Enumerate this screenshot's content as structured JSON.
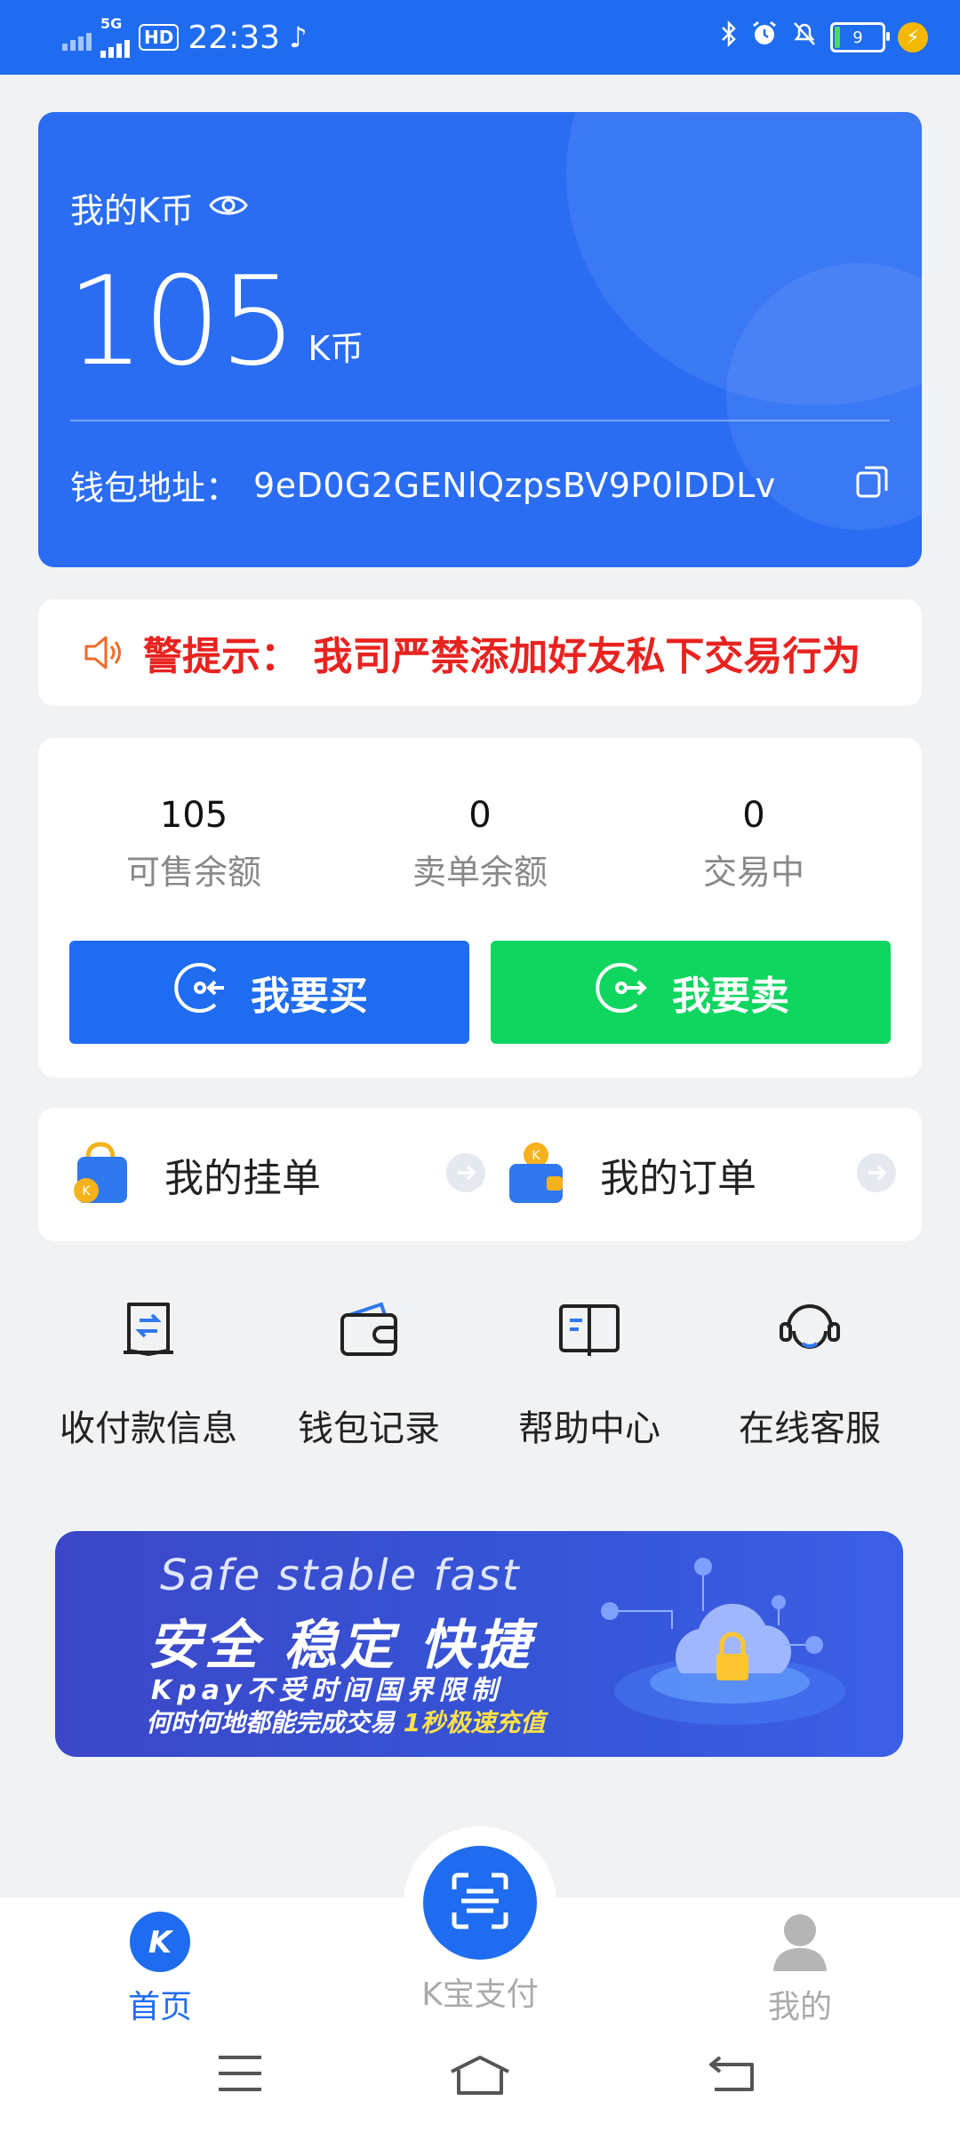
{
  "status_bar": {
    "network": "5G",
    "hd": "HD",
    "time": "22:33",
    "battery": "9"
  },
  "wallet_card": {
    "title": "我的K币",
    "amount": "105",
    "unit": "K币",
    "address_label": "钱包地址：",
    "address_value": "9eD0G2GENlQzpsBV9P0lDDLv"
  },
  "notice": {
    "text": "警提示：  我司严禁添加好友私下交易行为"
  },
  "balances": [
    {
      "value": "105",
      "label": "可售余额"
    },
    {
      "value": "0",
      "label": "卖单余额"
    },
    {
      "value": "0",
      "label": "交易中"
    }
  ],
  "actions": {
    "buy_label": "我要买",
    "sell_label": "我要卖"
  },
  "orders": {
    "my_listings": "我的挂单",
    "my_orders": "我的订单"
  },
  "quick_links": [
    {
      "label": "收付款信息",
      "icon": "receipt-exchange-icon"
    },
    {
      "label": "钱包记录",
      "icon": "wallet-icon"
    },
    {
      "label": "帮助中心",
      "icon": "book-icon"
    },
    {
      "label": "在线客服",
      "icon": "headset-icon"
    }
  ],
  "banner": {
    "line1": "Safe  stable  fast",
    "line2": "安全  稳定  快捷",
    "line3": "Kpay不受时间国界限制",
    "line4_prefix": "何时何地都能完成交易 ",
    "line4_highlight": "1秒极速充值"
  },
  "tab_bar": {
    "home": "首页",
    "pay": "K宝支付",
    "mine": "我的",
    "active_color": "#1f6cf0",
    "inactive_color": "#aaaaaa"
  },
  "colors": {
    "primary": "#1f6cf0",
    "sell": "#0fd65f",
    "notice": "#e8231f"
  }
}
